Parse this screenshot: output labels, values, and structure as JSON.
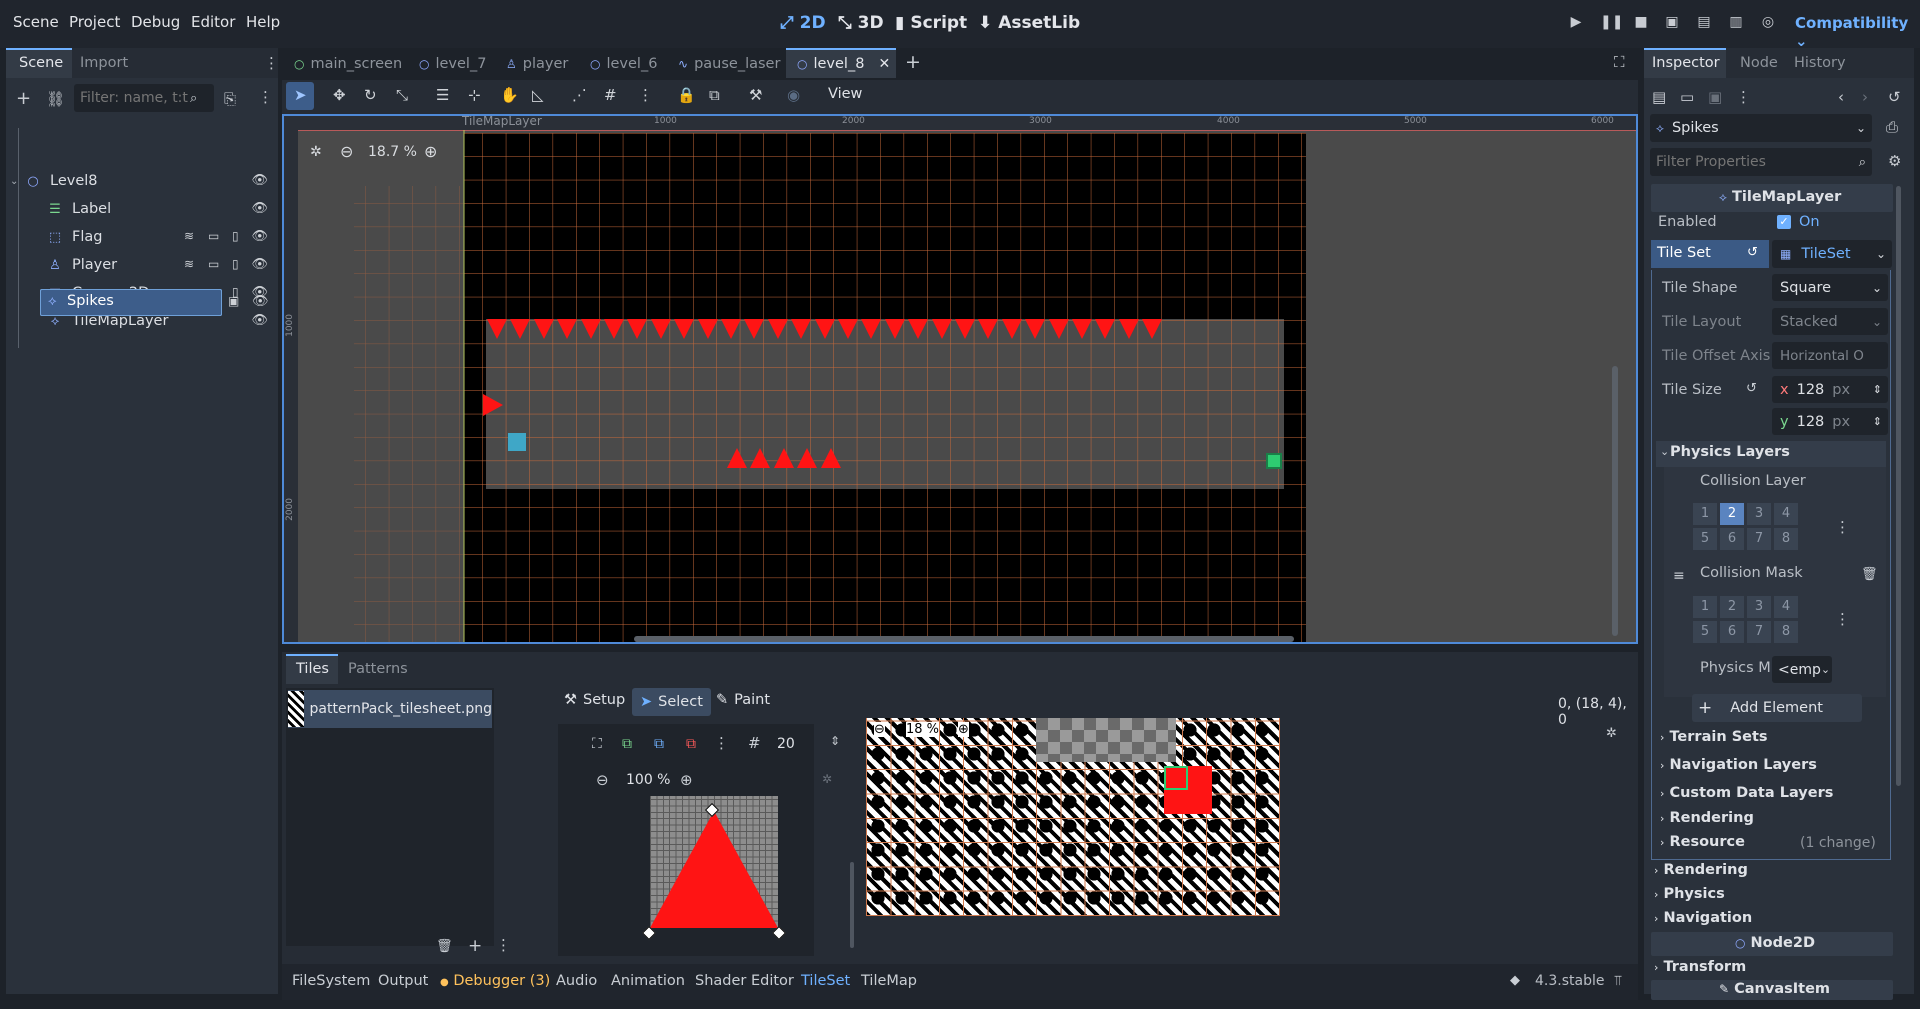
{
  "menus": [
    "Scene",
    "Project",
    "Debug",
    "Editor",
    "Help"
  ],
  "workspaces": [
    {
      "label": "2D",
      "icon": "2d-icon"
    },
    {
      "label": "3D",
      "icon": "3d-icon"
    },
    {
      "label": "Script",
      "icon": "script-icon"
    },
    {
      "label": "AssetLib",
      "icon": "assetlib-icon"
    }
  ],
  "renderer": "Compatibility",
  "scene_dock": {
    "tabs": [
      "Scene",
      "Import"
    ],
    "filter_placeholder": "Filter: name, t:t",
    "nodes": [
      {
        "name": "Level8",
        "icon": "node2d-icon",
        "color": "#8fa9ff"
      },
      {
        "name": "Label",
        "icon": "label-icon",
        "color": "#7bd88f"
      },
      {
        "name": "Flag",
        "icon": "area2d-icon",
        "color": "#8fb0ff"
      },
      {
        "name": "Player",
        "icon": "characterbody2d-icon",
        "color": "#8fb0ff"
      },
      {
        "name": "Camera2D",
        "icon": "camera-icon",
        "color": "#8fb0ff"
      },
      {
        "name": "TileMapLayer",
        "icon": "tilemaplayer-icon",
        "color": "#8fb0ff"
      },
      {
        "name": "Spikes",
        "icon": "tilemaplayer-icon",
        "color": "#8fb0ff"
      }
    ]
  },
  "doc_tabs": [
    "main_screen",
    "level_7",
    "player",
    "level_6",
    "pause_laser",
    "level_8"
  ],
  "viewport": {
    "zoom": "18.7 %",
    "overlay_label": "TileMapLayer",
    "view_label": "View",
    "ruler": [
      "1000",
      "2000",
      "3000",
      "4000",
      "5000",
      "6000"
    ],
    "ruler_v": [
      "1000",
      "2000"
    ]
  },
  "tiles_panel": {
    "tabs": [
      "Tiles",
      "Patterns"
    ],
    "tileset_item": "patternPack_tilesheet.png",
    "modes": [
      "Setup",
      "Select",
      "Paint"
    ],
    "grid_size": "20",
    "zoom": "100 %",
    "atlas_zoom": "18 %",
    "coords": "0, (18, 4), 0"
  },
  "bottom_tabs": [
    "FileSystem",
    "Output",
    "Debugger (3)",
    "Audio",
    "Animation",
    "Shader Editor",
    "TileSet",
    "TileMap"
  ],
  "version": "4.3.stable",
  "inspector": {
    "tabs": [
      "Inspector",
      "Node",
      "History"
    ],
    "node": "Spikes",
    "filter_placeholder": "Filter Properties",
    "class_header": "TileMapLayer",
    "enabled_label": "Enabled",
    "enabled_value": "On",
    "tileset_label": "Tile Set",
    "tileset_value": "TileSet",
    "tile_shape": {
      "label": "Tile Shape",
      "value": "Square"
    },
    "tile_layout": {
      "label": "Tile Layout",
      "value": "Stacked"
    },
    "tile_offset_axis": {
      "label": "Tile Offset Axis",
      "value": "Horizontal O"
    },
    "tile_size": {
      "label": "Tile Size",
      "x": "128",
      "y": "128",
      "unit": "px"
    },
    "physics_layers": "Physics Layers",
    "collision_layer": "Collision Layer",
    "collision_mask": "Collision Mask",
    "layer_bits": [
      "1",
      "2",
      "3",
      "4",
      "5",
      "6",
      "7",
      "8"
    ],
    "physics_material": {
      "label": "Physics M",
      "value": "<emp"
    },
    "add_element": "Add Element",
    "sections": [
      "Terrain Sets",
      "Navigation Layers",
      "Custom Data Layers",
      "Rendering",
      "Resource"
    ],
    "resource_changes": "(1 change)",
    "outer_sections": [
      "Rendering",
      "Physics",
      "Navigation"
    ],
    "node2d_header": "Node2D",
    "transform": "Transform",
    "canvasitem_header": "CanvasItem"
  },
  "colors": {
    "accent": "#6fb1ff",
    "selection": "#3d5d8a",
    "spike": "#ff1414",
    "tile_grid": "#d07a4e"
  }
}
